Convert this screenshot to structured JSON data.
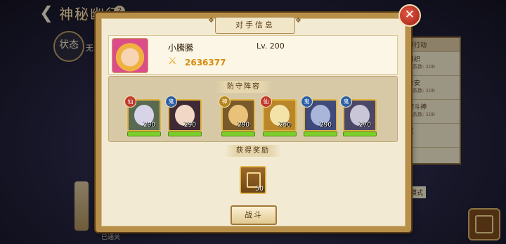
{
  "background": {
    "title": "神秘幽径",
    "status_label": "状态",
    "status_text": "无",
    "right_panel": {
      "header": "掉行动",
      "items": [
        {
          "name": "口织",
          "sub": "关系数: 100"
        },
        {
          "name": "世安",
          "sub": "关系数: 100"
        },
        {
          "name": "黎斗神",
          "sub": "关系数: 100"
        },
        {
          "name": "灵",
          "sub": ""
        }
      ]
    },
    "right_box_label": "模式",
    "cleared_label": "已通关"
  },
  "modal": {
    "title": "对手信息",
    "close_label": "✕",
    "player": {
      "name": "小騰騰",
      "level": "Lv. 200",
      "power": "2636377"
    },
    "defense_title": "防守阵容",
    "heroes": [
      {
        "badge": "仙",
        "badge_color": "#c0392b",
        "level": "290",
        "face_color": "#d8d4e8",
        "bg": "#5a6a52"
      },
      {
        "badge": "鬼",
        "badge_color": "#2c5fa8",
        "level": "290",
        "face_color": "#f1d8c6",
        "bg": "#3d2a35"
      },
      {
        "badge": "神",
        "badge_color": "#b8861b",
        "level": "290",
        "face_color": "#e9c27a",
        "bg": "#7a5a2a"
      },
      {
        "badge": "仙",
        "badge_color": "#c0392b",
        "level": "250",
        "face_color": "#f3e3a8",
        "bg": "#b9862a"
      },
      {
        "badge": "鬼",
        "badge_color": "#2c5fa8",
        "level": "290",
        "face_color": "#a9b6d9",
        "bg": "#3f4a7a"
      },
      {
        "badge": "鬼",
        "badge_color": "#2c5fa8",
        "level": "270",
        "face_color": "#c9c6d8",
        "bg": "#4b4766"
      }
    ],
    "reward_title": "获得奖励",
    "reward": {
      "count": "50"
    },
    "battle_label": "战斗"
  }
}
